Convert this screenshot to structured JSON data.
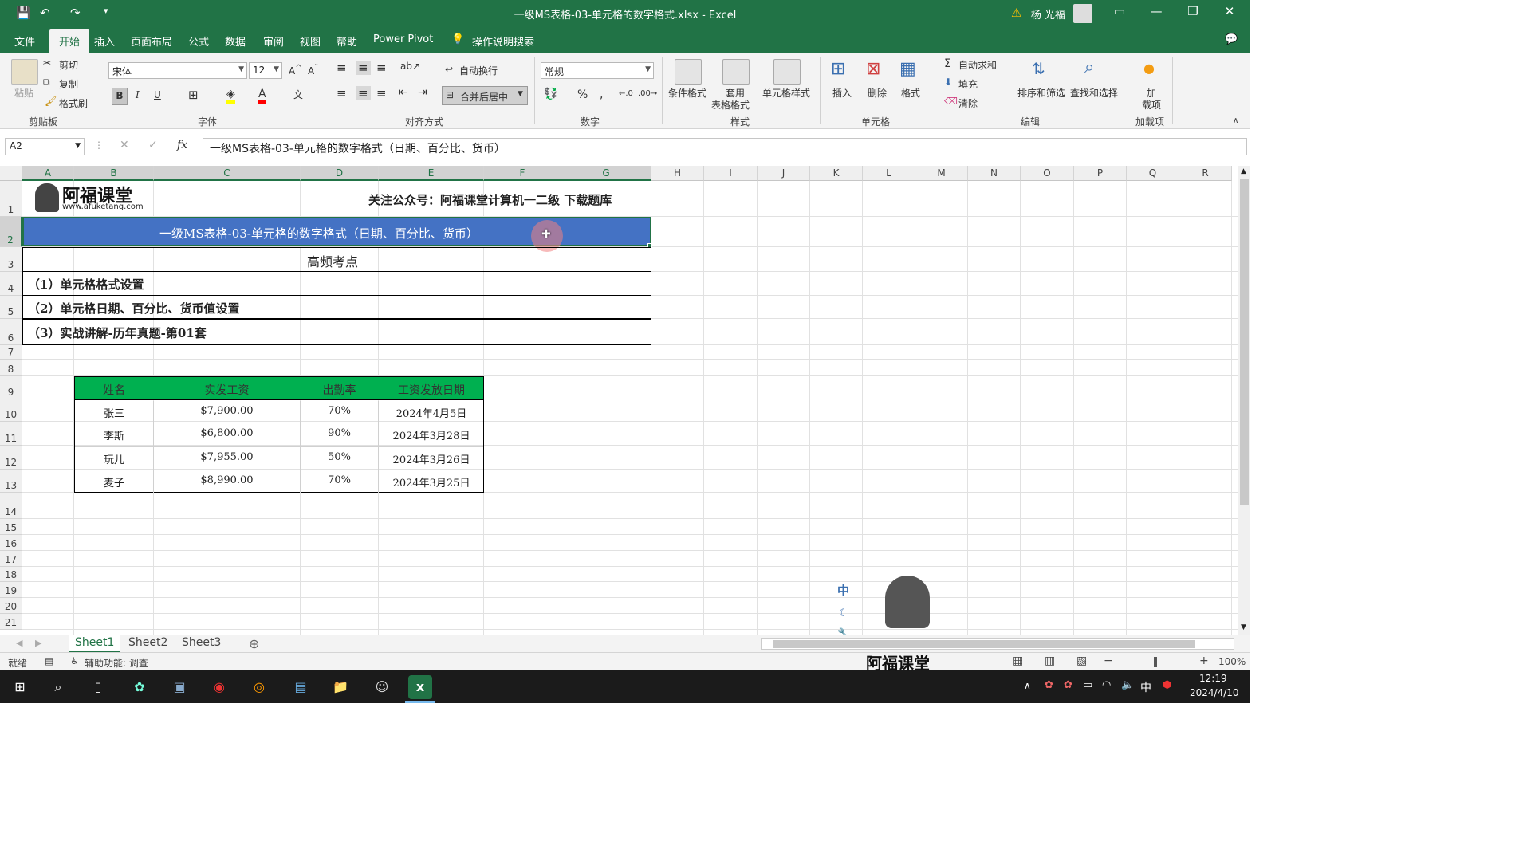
{
  "window": {
    "title": "一级MS表格-03-单元格的数字格式.xlsx  -  Excel",
    "user": "杨 光福"
  },
  "menu": {
    "tabs": [
      "文件",
      "开始",
      "插入",
      "页面布局",
      "公式",
      "数据",
      "审阅",
      "视图",
      "帮助",
      "Power Pivot"
    ],
    "active": "开始",
    "search": "操作说明搜索"
  },
  "ribbon": {
    "clipboard": {
      "paste": "粘贴",
      "cut": "剪切",
      "copy": "复制",
      "format_painter": "格式刷",
      "label": "剪贴板"
    },
    "font": {
      "name": "宋体",
      "size": "12",
      "bold": "B",
      "italic": "I",
      "underline": "U",
      "label": "字体"
    },
    "alignment": {
      "wrap": "自动换行",
      "merge": "合并后居中",
      "label": "对齐方式"
    },
    "number": {
      "format": "常规",
      "percent": "%",
      "comma": ",",
      "label": "数字"
    },
    "styles": {
      "conditional": "条件格式",
      "table_line1": "套用",
      "table_line2": "表格格式",
      "cell_styles": "单元格样式",
      "label": "样式"
    },
    "cells": {
      "insert": "插入",
      "delete": "删除",
      "format": "格式",
      "label": "单元格"
    },
    "editing": {
      "autosum": "自动求和",
      "fill": "填充",
      "clear": "清除",
      "sort": "排序和筛选",
      "find": "查找和选择",
      "label": "编辑"
    },
    "addins": {
      "line1": "加",
      "line2": "载项",
      "label": "加载项"
    }
  },
  "formula_bar": {
    "name_box": "A2",
    "fx": "fx",
    "content": "一级MS表格-03-单元格的数字格式（日期、百分比、货币）"
  },
  "columns": [
    "A",
    "B",
    "C",
    "D",
    "E",
    "F",
    "G",
    "H",
    "I",
    "J",
    "K",
    "L",
    "M",
    "N",
    "O",
    "P",
    "Q",
    "R"
  ],
  "rows": [
    "1",
    "2",
    "3",
    "4",
    "5",
    "6",
    "7",
    "8",
    "9",
    "10",
    "11",
    "12",
    "13",
    "14",
    "15",
    "16",
    "17",
    "18",
    "19",
    "20",
    "21"
  ],
  "sheet": {
    "logo_name": "阿福课堂",
    "logo_url": "www.afuketang.com",
    "follow_text": "关注公众号：阿福课堂计算机一二级  下载题库",
    "title": "一级MS表格-03-单元格的数字格式（日期、百分比、货币）",
    "subtitle": "高频考点",
    "points": [
      "（1）单元格格式设置",
      "（2）单元格日期、百分比、货币值设置",
      "（3）实战讲解-历年真题-第01套"
    ],
    "table": {
      "headers": [
        "姓名",
        "实发工资",
        "出勤率",
        "工资发放日期"
      ],
      "rows": [
        [
          "张三",
          "$7,900.00",
          "70%",
          "2024年4月5日"
        ],
        [
          "李斯",
          "$6,800.00",
          "90%",
          "2024年3月28日"
        ],
        [
          "玩儿",
          "$7,955.00",
          "50%",
          "2024年3月26日"
        ],
        [
          "麦子",
          "$8,990.00",
          "70%",
          "2024年3月25日"
        ]
      ]
    }
  },
  "sheet_tabs": [
    "Sheet1",
    "Sheet2",
    "Sheet3"
  ],
  "status": {
    "ready": "就绪",
    "accessibility": "辅助功能: 调查",
    "zoom": "100%"
  },
  "overlay": {
    "ime_char": "中",
    "watermark": "阿福课堂"
  },
  "taskbar": {
    "time": "12:19",
    "date": "2024/4/10",
    "ime": "中"
  },
  "colors": {
    "excel_green": "#217346",
    "title_fill": "#4472c4",
    "table_header": "#00b050"
  }
}
